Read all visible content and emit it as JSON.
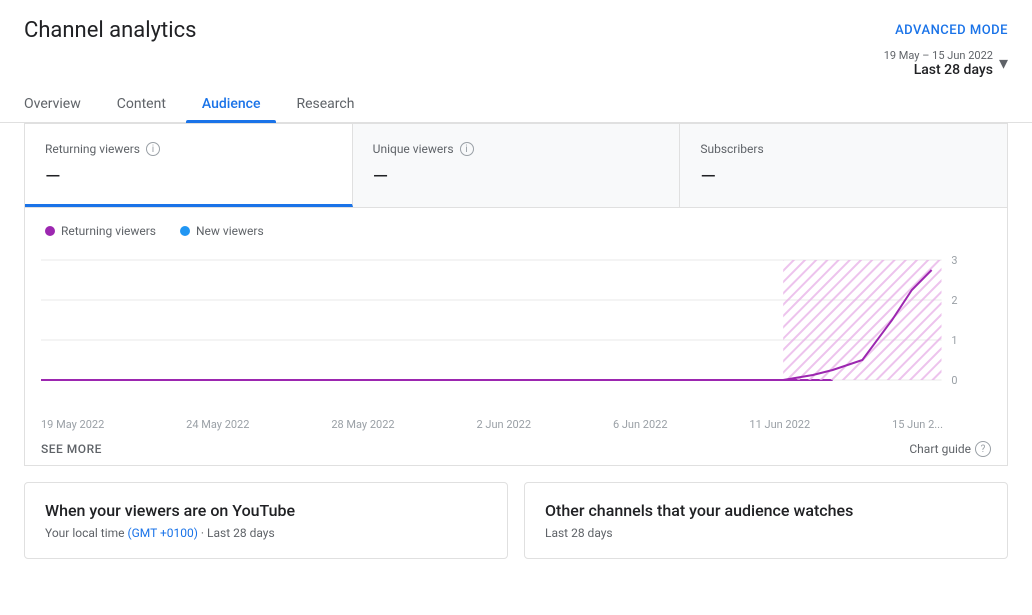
{
  "page": {
    "title": "Channel analytics",
    "advanced_mode_label": "ADVANCED MODE"
  },
  "date_range": {
    "label": "19 May – 15 Jun 2022",
    "value": "Last 28 days"
  },
  "tabs": [
    {
      "id": "overview",
      "label": "Overview",
      "active": false
    },
    {
      "id": "content",
      "label": "Content",
      "active": false
    },
    {
      "id": "audience",
      "label": "Audience",
      "active": true
    },
    {
      "id": "research",
      "label": "Research",
      "active": false
    }
  ],
  "metrics": [
    {
      "id": "returning-viewers",
      "label": "Returning viewers",
      "has_info": true,
      "value": "—",
      "active": true
    },
    {
      "id": "unique-viewers",
      "label": "Unique viewers",
      "has_info": true,
      "value": "—",
      "active": false
    },
    {
      "id": "subscribers",
      "label": "Subscribers",
      "has_info": false,
      "value": "—",
      "active": false
    }
  ],
  "legend": [
    {
      "id": "returning",
      "label": "Returning viewers",
      "color": "#9c27b0"
    },
    {
      "id": "new",
      "label": "New viewers",
      "color": "#2196f3"
    }
  ],
  "chart": {
    "y_labels": [
      "3",
      "2",
      "1",
      "0"
    ],
    "x_labels": [
      "19 May 2022",
      "24 May 2022",
      "28 May 2022",
      "2 Jun 2022",
      "6 Jun 2022",
      "11 Jun 2022",
      "15 Jun 2..."
    ],
    "see_more_label": "SEE MORE",
    "chart_guide_label": "Chart guide"
  },
  "bottom_cards": [
    {
      "id": "viewers-on-youtube",
      "title": "When your viewers are on YouTube",
      "subtitle_prefix": "Your local time ",
      "subtitle_gmt": "(GMT +0100)",
      "subtitle_suffix": " · Last 28 days"
    },
    {
      "id": "other-channels",
      "title": "Other channels that your audience watches",
      "subtitle": "Last 28 days"
    }
  ]
}
